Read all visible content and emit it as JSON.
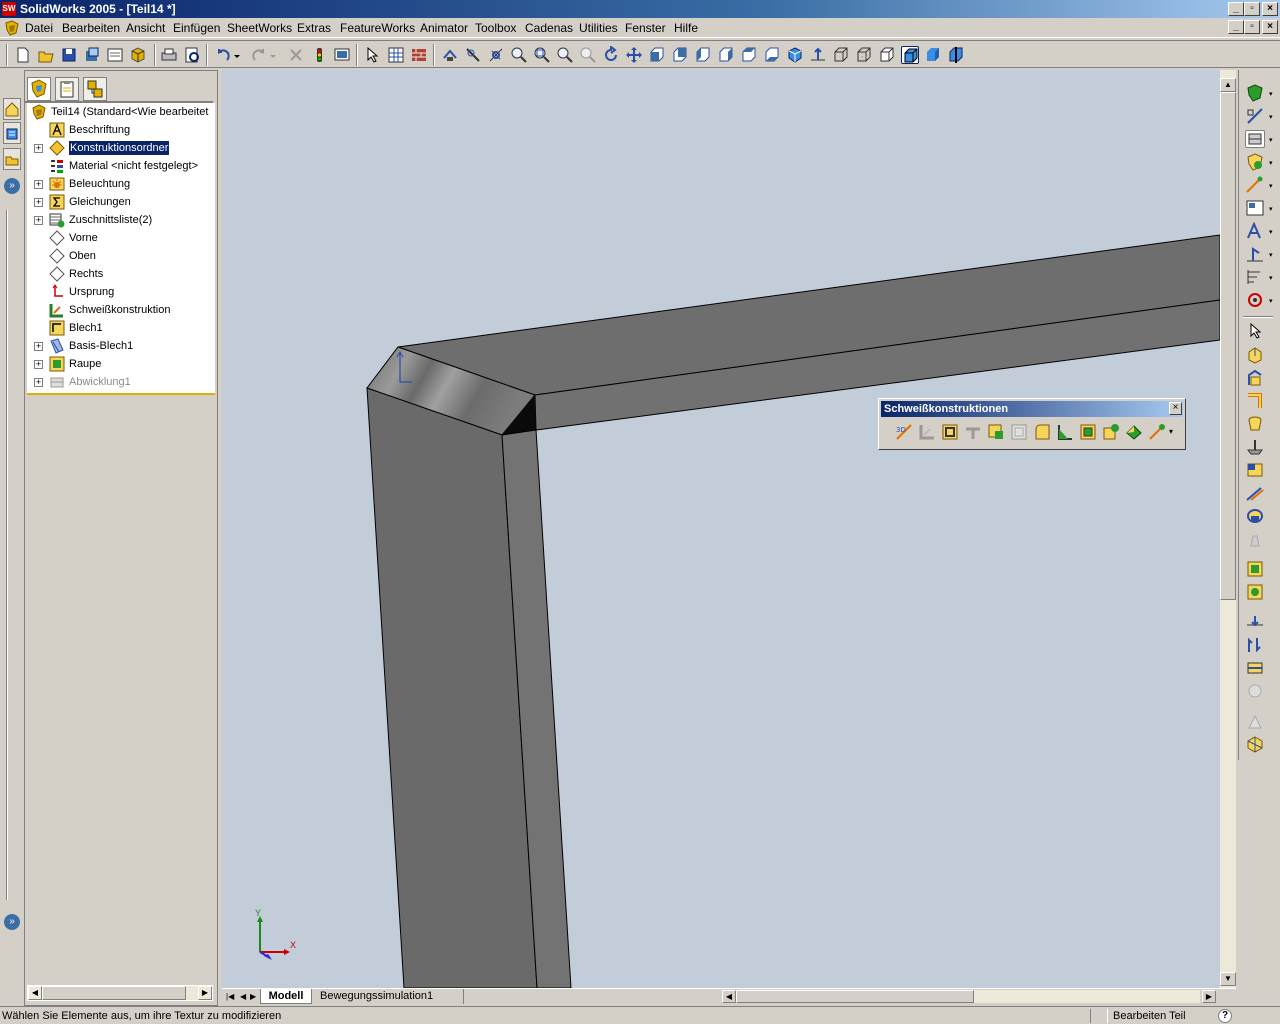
{
  "window": {
    "title": "SolidWorks 2005 - [Teil14 *]"
  },
  "menu": [
    "Datei",
    "Bearbeiten",
    "Ansicht",
    "Einfügen",
    "SheetWorks",
    "Extras",
    "FeatureWorks",
    "Animator",
    "Toolbox",
    "Cadenas",
    "Utilities",
    "Fenster",
    "Hilfe"
  ],
  "tree": {
    "root": "Teil14  (Standard<Wie bearbeitet",
    "items": [
      {
        "label": "Beschriftung",
        "icon": "annotation-icon",
        "expand": false
      },
      {
        "label": "Konstruktionsordner",
        "icon": "design-folder-icon",
        "expand": true,
        "selected": true
      },
      {
        "label": "Material <nicht festgelegt>",
        "icon": "material-icon",
        "expand": false
      },
      {
        "label": "Beleuchtung",
        "icon": "lighting-icon",
        "expand": true
      },
      {
        "label": "Gleichungen",
        "icon": "equations-icon",
        "expand": true
      },
      {
        "label": "Zuschnittsliste(2)",
        "icon": "cutlist-icon",
        "expand": true
      },
      {
        "label": "Vorne",
        "icon": "plane-icon",
        "expand": false
      },
      {
        "label": "Oben",
        "icon": "plane-icon",
        "expand": false
      },
      {
        "label": "Rechts",
        "icon": "plane-icon",
        "expand": false
      },
      {
        "label": "Ursprung",
        "icon": "origin-icon",
        "expand": false
      },
      {
        "label": "Schweißkonstruktion",
        "icon": "weldment-icon",
        "expand": false
      },
      {
        "label": "Blech1",
        "icon": "sheetmetal-icon",
        "expand": false
      },
      {
        "label": "Basis-Blech1",
        "icon": "base-flange-icon",
        "expand": true
      },
      {
        "label": "Raupe",
        "icon": "bead-icon",
        "expand": true
      },
      {
        "label": "Abwicklung1",
        "icon": "flat-pattern-icon",
        "expand": true,
        "disabled": true
      }
    ]
  },
  "weld_toolbar": {
    "title": "Schweißkonstruktionen"
  },
  "tabs": {
    "model": "Modell",
    "motion": "Bewegungssimulation1"
  },
  "status": {
    "message": "Wählen Sie Elemente aus, um ihre Textur zu modifizieren",
    "mode": "Bearbeiten Teil",
    "help": "?"
  },
  "triad": {
    "x": "X",
    "y": "Y"
  },
  "colors": {
    "viewport": "#c3ccd9",
    "part": "#6b6b6b",
    "selection": "#0a246a"
  }
}
